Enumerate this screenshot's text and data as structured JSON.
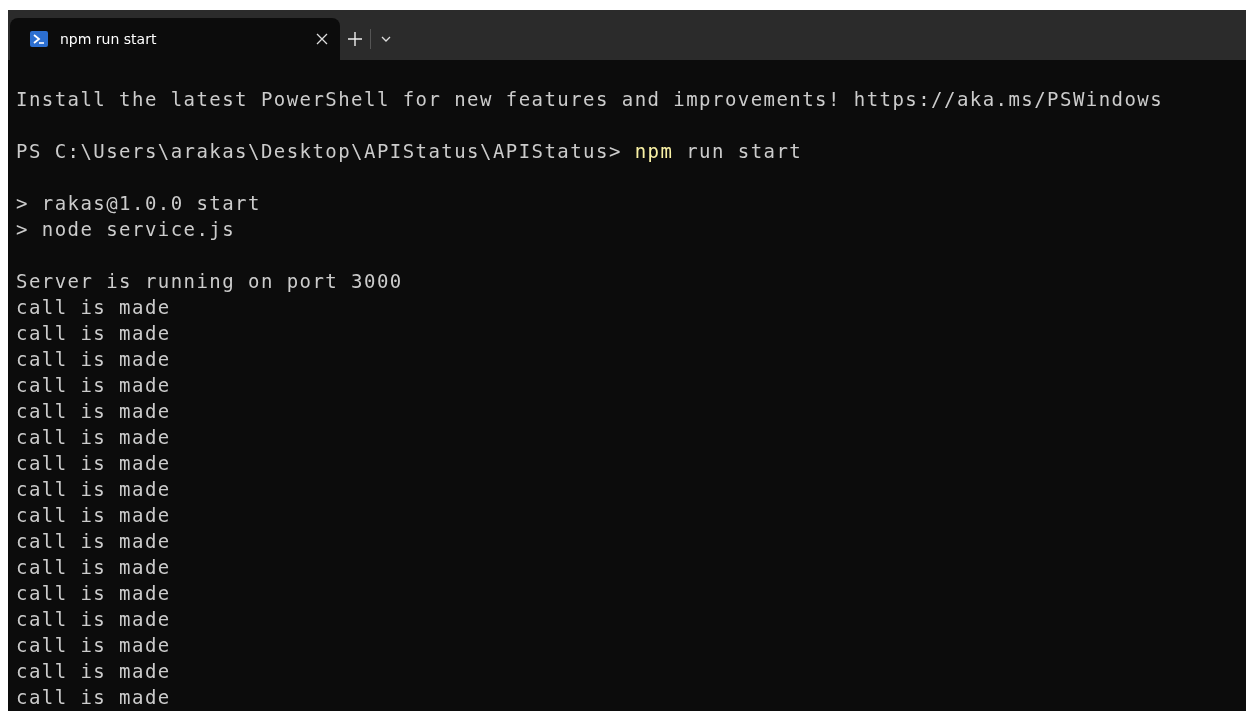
{
  "tab": {
    "title": "npm run start",
    "selected": true
  },
  "lines": [
    {
      "kind": "blank"
    },
    {
      "kind": "text",
      "text": "Install the latest PowerShell for new features and improvements! https://aka.ms/PSWindows"
    },
    {
      "kind": "blank"
    },
    {
      "kind": "prompt",
      "prompt": "PS C:\\Users\\arakas\\Desktop\\APIStatus\\APIStatus>",
      "command": "npm",
      "args": "run start"
    },
    {
      "kind": "blank"
    },
    {
      "kind": "text",
      "text": "> rakas@1.0.0 start"
    },
    {
      "kind": "text",
      "text": "> node service.js"
    },
    {
      "kind": "blank"
    },
    {
      "kind": "text",
      "text": "Server is running on port 3000"
    },
    {
      "kind": "text",
      "text": "call is made"
    },
    {
      "kind": "text",
      "text": "call is made"
    },
    {
      "kind": "text",
      "text": "call is made"
    },
    {
      "kind": "text",
      "text": "call is made"
    },
    {
      "kind": "text",
      "text": "call is made"
    },
    {
      "kind": "text",
      "text": "call is made"
    },
    {
      "kind": "text",
      "text": "call is made"
    },
    {
      "kind": "text",
      "text": "call is made"
    },
    {
      "kind": "text",
      "text": "call is made"
    },
    {
      "kind": "text",
      "text": "call is made"
    },
    {
      "kind": "text",
      "text": "call is made"
    },
    {
      "kind": "text",
      "text": "call is made"
    },
    {
      "kind": "text",
      "text": "call is made"
    },
    {
      "kind": "text",
      "text": "call is made"
    },
    {
      "kind": "text",
      "text": "call is made"
    },
    {
      "kind": "text",
      "text": "call is made"
    }
  ]
}
